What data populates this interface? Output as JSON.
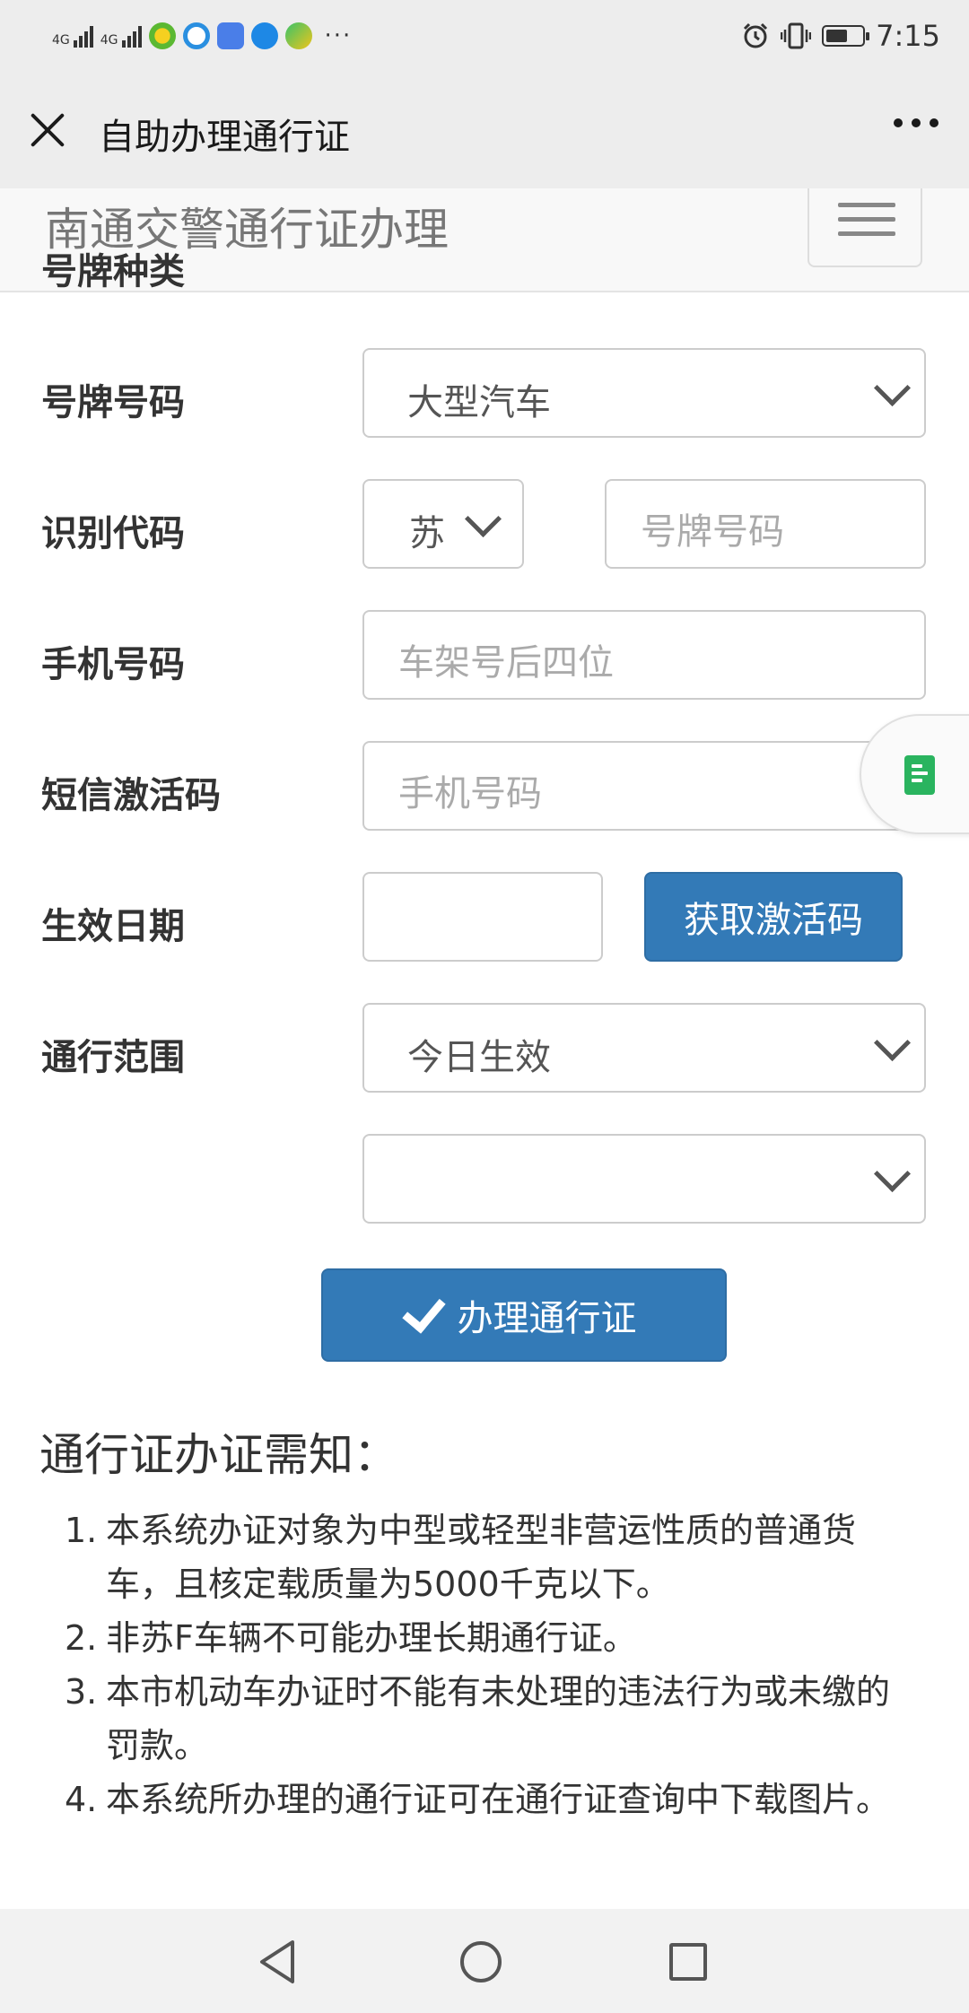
{
  "status_bar": {
    "network_1": "4G",
    "network_2": "4G",
    "more": "···",
    "time": "7:15",
    "battery_level": 0.6,
    "icons": [
      "alarm-icon",
      "vibrate-icon",
      "battery-icon"
    ]
  },
  "nav": {
    "title": "自助办理通行证"
  },
  "site": {
    "brand": "南通交警通行证办理"
  },
  "form": {
    "plate_type": {
      "label": "号牌种类",
      "value": "大型汽车"
    },
    "plate_number": {
      "label": "号牌号码",
      "province": "苏",
      "placeholder": "号牌号码"
    },
    "vin": {
      "label": "识别代码",
      "placeholder": "车架号后四位"
    },
    "phone": {
      "label": "手机号码",
      "placeholder": "手机号码"
    },
    "sms": {
      "label": "短信激活码",
      "value": "",
      "button": "获取激活码"
    },
    "effective_date": {
      "label": "生效日期",
      "value": "今日生效"
    },
    "scope": {
      "label": "通行范围",
      "value": ""
    },
    "submit": "办理通行证"
  },
  "notice": {
    "title": "通行证办证需知：",
    "items": [
      {
        "num": "1.",
        "text": "本系统办证对象为中型或轻型非营运性质的普通货车，且核定载质量为5000千克以下。"
      },
      {
        "num": "2.",
        "text": "非苏F车辆不可能办理长期通行证。"
      },
      {
        "num": "3.",
        "text": "本市机动车办证时不能有未处理的违法行为或未缴的罚款。"
      },
      {
        "num": "4.",
        "text": "本系统所办理的通行证可在通行证查询中下载图片。"
      }
    ]
  },
  "colors": {
    "primary": "#337ab7",
    "nav_bg": "#ededed",
    "header_bg": "#f8f8f8",
    "float_icon": "#2ab45f"
  }
}
